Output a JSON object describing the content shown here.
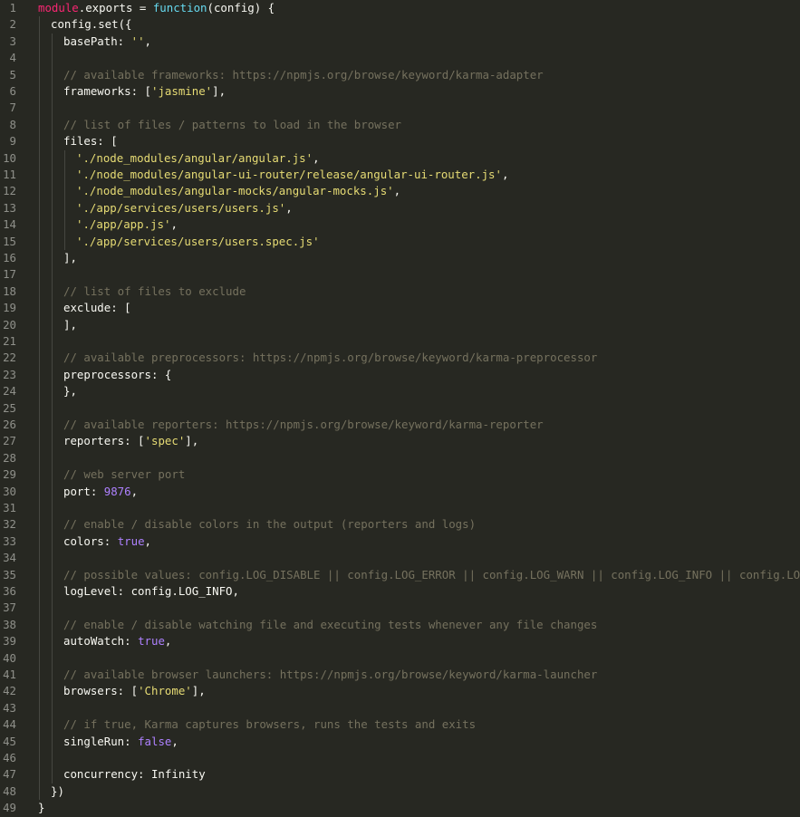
{
  "theme": {
    "background": "#272822",
    "line_number": "#8f908a",
    "plain": "#f8f8f2",
    "keyword": "#f92672",
    "string": "#e6db74",
    "number": "#ae81ff",
    "comment": "#75715e"
  },
  "lines": [
    {
      "n": "1",
      "indent": 0,
      "tokens": [
        [
          "obj",
          "module"
        ],
        [
          "plain",
          ".exports = "
        ],
        [
          "fn",
          "function"
        ],
        [
          "plain",
          "(config) {"
        ]
      ]
    },
    {
      "n": "2",
      "indent": 1,
      "tokens": [
        [
          "plain",
          "config.set({"
        ]
      ]
    },
    {
      "n": "3",
      "indent": 2,
      "tokens": [
        [
          "plain",
          "basePath: "
        ],
        [
          "str",
          "''"
        ],
        [
          "plain",
          ","
        ]
      ]
    },
    {
      "n": "4",
      "indent": 2,
      "tokens": []
    },
    {
      "n": "5",
      "indent": 2,
      "tokens": [
        [
          "cmt",
          "// available frameworks: https://npmjs.org/browse/keyword/karma-adapter"
        ]
      ]
    },
    {
      "n": "6",
      "indent": 2,
      "tokens": [
        [
          "plain",
          "frameworks: ["
        ],
        [
          "str",
          "'jasmine'"
        ],
        [
          "plain",
          "],"
        ]
      ]
    },
    {
      "n": "7",
      "indent": 2,
      "tokens": []
    },
    {
      "n": "8",
      "indent": 2,
      "tokens": [
        [
          "cmt",
          "// list of files / patterns to load in the browser"
        ]
      ]
    },
    {
      "n": "9",
      "indent": 2,
      "tokens": [
        [
          "plain",
          "files: ["
        ]
      ]
    },
    {
      "n": "10",
      "indent": 3,
      "tokens": [
        [
          "str",
          "'./node_modules/angular/angular.js'"
        ],
        [
          "plain",
          ","
        ]
      ]
    },
    {
      "n": "11",
      "indent": 3,
      "tokens": [
        [
          "str",
          "'./node_modules/angular-ui-router/release/angular-ui-router.js'"
        ],
        [
          "plain",
          ","
        ]
      ]
    },
    {
      "n": "12",
      "indent": 3,
      "tokens": [
        [
          "str",
          "'./node_modules/angular-mocks/angular-mocks.js'"
        ],
        [
          "plain",
          ","
        ]
      ]
    },
    {
      "n": "13",
      "indent": 3,
      "tokens": [
        [
          "str",
          "'./app/services/users/users.js'"
        ],
        [
          "plain",
          ","
        ]
      ]
    },
    {
      "n": "14",
      "indent": 3,
      "tokens": [
        [
          "str",
          "'./app/app.js'"
        ],
        [
          "plain",
          ","
        ]
      ]
    },
    {
      "n": "15",
      "indent": 3,
      "tokens": [
        [
          "str",
          "'./app/services/users/users.spec.js'"
        ]
      ]
    },
    {
      "n": "16",
      "indent": 2,
      "tokens": [
        [
          "plain",
          "],"
        ]
      ]
    },
    {
      "n": "17",
      "indent": 2,
      "tokens": []
    },
    {
      "n": "18",
      "indent": 2,
      "tokens": [
        [
          "cmt",
          "// list of files to exclude"
        ]
      ]
    },
    {
      "n": "19",
      "indent": 2,
      "tokens": [
        [
          "plain",
          "exclude: ["
        ]
      ]
    },
    {
      "n": "20",
      "indent": 2,
      "tokens": [
        [
          "plain",
          "],"
        ]
      ]
    },
    {
      "n": "21",
      "indent": 2,
      "tokens": []
    },
    {
      "n": "22",
      "indent": 2,
      "tokens": [
        [
          "cmt",
          "// available preprocessors: https://npmjs.org/browse/keyword/karma-preprocessor"
        ]
      ]
    },
    {
      "n": "23",
      "indent": 2,
      "tokens": [
        [
          "plain",
          "preprocessors: {"
        ]
      ]
    },
    {
      "n": "24",
      "indent": 2,
      "tokens": [
        [
          "plain",
          "},"
        ]
      ]
    },
    {
      "n": "25",
      "indent": 2,
      "tokens": []
    },
    {
      "n": "26",
      "indent": 2,
      "tokens": [
        [
          "cmt",
          "// available reporters: https://npmjs.org/browse/keyword/karma-reporter"
        ]
      ]
    },
    {
      "n": "27",
      "indent": 2,
      "tokens": [
        [
          "plain",
          "reporters: ["
        ],
        [
          "str",
          "'spec'"
        ],
        [
          "plain",
          "],"
        ]
      ]
    },
    {
      "n": "28",
      "indent": 2,
      "tokens": []
    },
    {
      "n": "29",
      "indent": 2,
      "tokens": [
        [
          "cmt",
          "// web server port"
        ]
      ]
    },
    {
      "n": "30",
      "indent": 2,
      "tokens": [
        [
          "plain",
          "port: "
        ],
        [
          "num",
          "9876"
        ],
        [
          "plain",
          ","
        ]
      ]
    },
    {
      "n": "31",
      "indent": 2,
      "tokens": []
    },
    {
      "n": "32",
      "indent": 2,
      "tokens": [
        [
          "cmt",
          "// enable / disable colors in the output (reporters and logs)"
        ]
      ]
    },
    {
      "n": "33",
      "indent": 2,
      "tokens": [
        [
          "plain",
          "colors: "
        ],
        [
          "bool",
          "true"
        ],
        [
          "plain",
          ","
        ]
      ]
    },
    {
      "n": "34",
      "indent": 2,
      "tokens": []
    },
    {
      "n": "35",
      "indent": 2,
      "tokens": [
        [
          "cmt",
          "// possible values: config.LOG_DISABLE || config.LOG_ERROR || config.LOG_WARN || config.LOG_INFO || config.LOG_DEBUG"
        ]
      ]
    },
    {
      "n": "36",
      "indent": 2,
      "tokens": [
        [
          "plain",
          "logLevel: config.LOG_INFO,"
        ]
      ]
    },
    {
      "n": "37",
      "indent": 2,
      "tokens": []
    },
    {
      "n": "38",
      "indent": 2,
      "tokens": [
        [
          "cmt",
          "// enable / disable watching file and executing tests whenever any file changes"
        ]
      ]
    },
    {
      "n": "39",
      "indent": 2,
      "tokens": [
        [
          "plain",
          "autoWatch: "
        ],
        [
          "bool",
          "true"
        ],
        [
          "plain",
          ","
        ]
      ]
    },
    {
      "n": "40",
      "indent": 2,
      "tokens": []
    },
    {
      "n": "41",
      "indent": 2,
      "tokens": [
        [
          "cmt",
          "// available browser launchers: https://npmjs.org/browse/keyword/karma-launcher"
        ]
      ]
    },
    {
      "n": "42",
      "indent": 2,
      "tokens": [
        [
          "plain",
          "browsers: ["
        ],
        [
          "str",
          "'Chrome'"
        ],
        [
          "plain",
          "],"
        ]
      ]
    },
    {
      "n": "43",
      "indent": 2,
      "tokens": []
    },
    {
      "n": "44",
      "indent": 2,
      "tokens": [
        [
          "cmt",
          "// if true, Karma captures browsers, runs the tests and exits"
        ]
      ]
    },
    {
      "n": "45",
      "indent": 2,
      "tokens": [
        [
          "plain",
          "singleRun: "
        ],
        [
          "bool",
          "false"
        ],
        [
          "plain",
          ","
        ]
      ]
    },
    {
      "n": "46",
      "indent": 2,
      "tokens": []
    },
    {
      "n": "47",
      "indent": 2,
      "tokens": [
        [
          "plain",
          "concurrency: Infinity"
        ]
      ]
    },
    {
      "n": "48",
      "indent": 1,
      "tokens": [
        [
          "plain",
          "})"
        ]
      ]
    },
    {
      "n": "49",
      "indent": 0,
      "tokens": [
        [
          "plain",
          "}"
        ]
      ]
    }
  ]
}
